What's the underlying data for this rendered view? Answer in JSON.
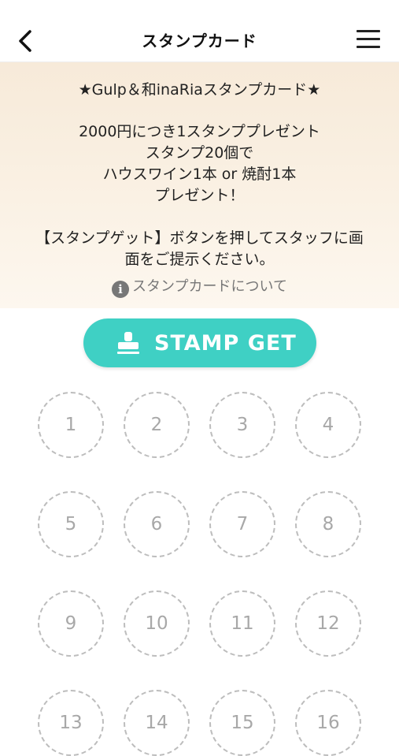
{
  "header": {
    "title": "スタンプカード",
    "back_icon": "chevron-left-icon",
    "menu_icon": "hamburger-menu-icon"
  },
  "info": {
    "card_title": "★Gulp＆和inaRiaスタンプカード★",
    "line1": "2000円につき1スタンププレゼント",
    "line2": "スタンプ20個で",
    "line3": "ハウスワイン1本 or 焼酎1本",
    "line4": "プレゼント！",
    "instruction1": "【スタンプゲット】ボタンを押してスタッフに画",
    "instruction2": "面をご提示ください。",
    "about_label": "スタンプカードについて",
    "about_icon": "info-icon"
  },
  "stamp_button": {
    "label": "STAMP GET",
    "icon": "stamp-icon",
    "color": "#3fd0c4"
  },
  "slots": [
    "1",
    "2",
    "3",
    "4",
    "5",
    "6",
    "7",
    "8",
    "9",
    "10",
    "11",
    "12",
    "13",
    "14",
    "15",
    "16"
  ]
}
